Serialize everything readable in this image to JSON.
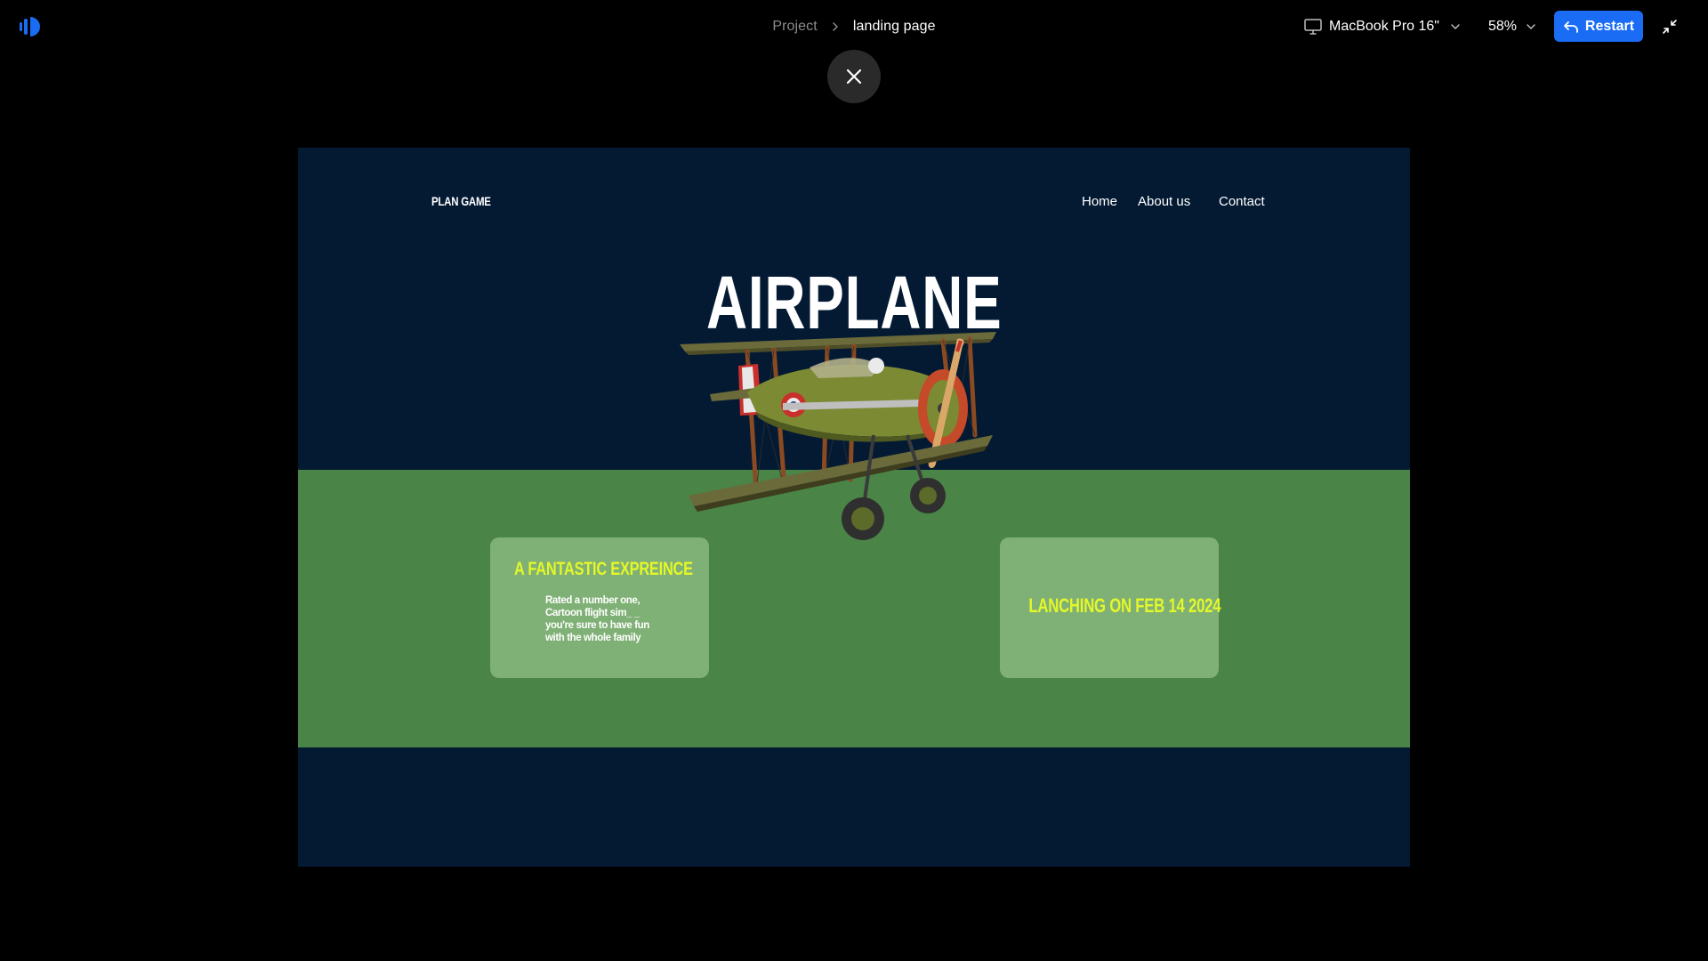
{
  "toolbar": {
    "logo_icon": "app-logo-icon",
    "breadcrumb": {
      "parent": "Project",
      "separator_icon": "chevron-right-icon",
      "current": "landing page"
    },
    "device": {
      "icon": "monitor-icon",
      "label": "MacBook Pro 16\"",
      "chevron_icon": "chevron-down-icon"
    },
    "zoom": {
      "label": "58%",
      "chevron_icon": "chevron-down-icon"
    },
    "restart": {
      "icon": "undo-arrow-icon",
      "label": "Restart",
      "color": "#1a6cf5"
    },
    "collapse_icon": "collapse-icon",
    "close_icon": "close-icon"
  },
  "preview": {
    "brand": "PLAN GAME",
    "nav": {
      "home": "Home",
      "about": "About us",
      "contact": "Contact"
    },
    "hero_title": "AIRPLANE",
    "hero_image": "biplane-illustration",
    "colors": {
      "navy": "#041a33",
      "green": "#4a8447",
      "card": "#7fb075",
      "accent": "#e4f72a"
    },
    "card_left": {
      "title": "A FANTASTIC EXPREINCE",
      "body": "Rated a number one, Cartoon flight sim_ _ you're sure to have fun with the whole family"
    },
    "card_right": {
      "title": "LANCHING ON FEB 14 2024"
    }
  }
}
